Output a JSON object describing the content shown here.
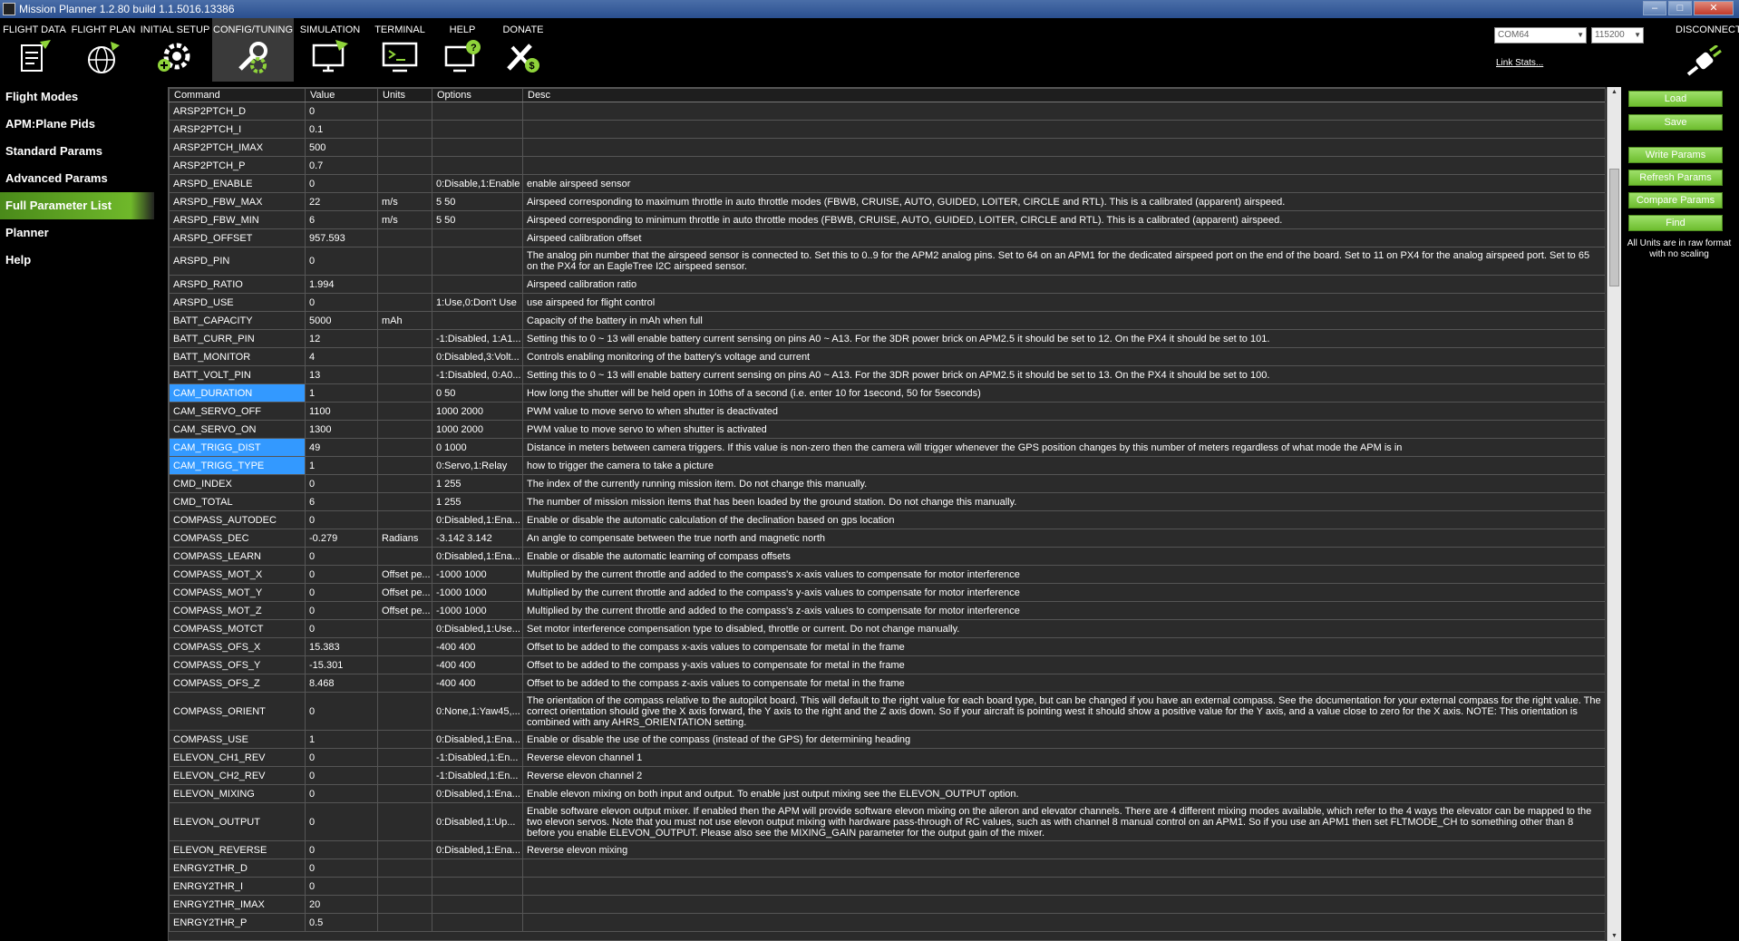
{
  "window": {
    "title": "Mission Planner 1.2.80 build 1.1.5016.13386",
    "controls": [
      "–",
      "□",
      "✕"
    ]
  },
  "toolbar": {
    "items": [
      {
        "label": "FLIGHT DATA",
        "icon": "flight-data-icon"
      },
      {
        "label": "FLIGHT PLAN",
        "icon": "flight-plan-icon"
      },
      {
        "label": "INITIAL SETUP",
        "icon": "initial-setup-icon"
      },
      {
        "label": "CONFIG/TUNING",
        "icon": "config-tuning-icon",
        "active": true
      },
      {
        "label": "SIMULATION",
        "icon": "simulation-icon"
      },
      {
        "label": "TERMINAL",
        "icon": "terminal-icon"
      },
      {
        "label": "HELP",
        "icon": "help-icon"
      },
      {
        "label": "DONATE",
        "icon": "donate-icon"
      }
    ],
    "port": "COM64",
    "baud": "115200",
    "link_stats": "Link Stats...",
    "disconnect": "DISCONNECT"
  },
  "sidebar": {
    "items": [
      {
        "label": "Flight Modes"
      },
      {
        "label": "APM:Plane Pids"
      },
      {
        "label": "Standard Params"
      },
      {
        "label": "Advanced Params"
      },
      {
        "label": "Full Parameter List",
        "active": true
      },
      {
        "label": "Planner"
      },
      {
        "label": "Help"
      }
    ]
  },
  "table": {
    "columns": [
      "Command",
      "Value",
      "Units",
      "Options",
      "Desc"
    ],
    "rows": [
      {
        "cmd": "ARSP2PTCH_D",
        "val": "0",
        "units": "",
        "opt": "",
        "desc": ""
      },
      {
        "cmd": "ARSP2PTCH_I",
        "val": "0.1",
        "units": "",
        "opt": "",
        "desc": ""
      },
      {
        "cmd": "ARSP2PTCH_IMAX",
        "val": "500",
        "units": "",
        "opt": "",
        "desc": ""
      },
      {
        "cmd": "ARSP2PTCH_P",
        "val": "0.7",
        "units": "",
        "opt": "",
        "desc": ""
      },
      {
        "cmd": "ARSPD_ENABLE",
        "val": "0",
        "units": "",
        "opt": "0:Disable,1:Enable",
        "desc": "enable airspeed sensor"
      },
      {
        "cmd": "ARSPD_FBW_MAX",
        "val": "22",
        "units": "m/s",
        "opt": "5 50",
        "desc": "Airspeed corresponding to maximum throttle in auto throttle modes (FBWB, CRUISE, AUTO, GUIDED, LOITER, CIRCLE and RTL). This is a calibrated (apparent) airspeed."
      },
      {
        "cmd": "ARSPD_FBW_MIN",
        "val": "6",
        "units": "m/s",
        "opt": "5 50",
        "desc": "Airspeed corresponding to minimum throttle in auto throttle modes (FBWB, CRUISE, AUTO, GUIDED, LOITER, CIRCLE and RTL). This is a calibrated (apparent) airspeed."
      },
      {
        "cmd": "ARSPD_OFFSET",
        "val": "957.593",
        "units": "",
        "opt": "",
        "desc": "Airspeed calibration offset"
      },
      {
        "cmd": "ARSPD_PIN",
        "val": "0",
        "units": "",
        "opt": "",
        "desc": "The analog pin number that the airspeed sensor is connected to. Set this to 0..9 for the APM2 analog pins. Set to 64 on an APM1 for the dedicated airspeed port on the end of the board. Set to 11 on PX4 for the analog airspeed port. Set to 65 on the PX4 for an EagleTree I2C airspeed sensor.",
        "h": "tall"
      },
      {
        "cmd": "ARSPD_RATIO",
        "val": "1.994",
        "units": "",
        "opt": "",
        "desc": "Airspeed calibration ratio"
      },
      {
        "cmd": "ARSPD_USE",
        "val": "0",
        "units": "",
        "opt": "1:Use,0:Don't Use",
        "desc": "use airspeed for flight control"
      },
      {
        "cmd": "BATT_CAPACITY",
        "val": "5000",
        "units": "mAh",
        "opt": "",
        "desc": "Capacity of the battery in mAh when full"
      },
      {
        "cmd": "BATT_CURR_PIN",
        "val": "12",
        "units": "",
        "opt": "-1:Disabled, 1:A1...",
        "desc": "Setting this to 0 ~ 13 will enable battery current sensing on pins A0 ~ A13. For the 3DR power brick on APM2.5 it should be set to 12. On the PX4 it should be set to 101."
      },
      {
        "cmd": "BATT_MONITOR",
        "val": "4",
        "units": "",
        "opt": "0:Disabled,3:Volt...",
        "desc": "Controls enabling monitoring of the battery's voltage and current"
      },
      {
        "cmd": "BATT_VOLT_PIN",
        "val": "13",
        "units": "",
        "opt": "-1:Disabled, 0:A0...",
        "desc": "Setting this to 0 ~ 13 will enable battery current sensing on pins A0 ~ A13. For the 3DR power brick on APM2.5 it should be set to 13. On the PX4 it should be set to 100."
      },
      {
        "cmd": "CAM_DURATION",
        "val": "1",
        "units": "",
        "opt": "0 50",
        "desc": "How long the shutter will be held open in 10ths of a second (i.e. enter 10 for 1second, 50 for 5seconds)",
        "sel": true
      },
      {
        "cmd": "CAM_SERVO_OFF",
        "val": "1100",
        "units": "",
        "opt": "1000 2000",
        "desc": "PWM value to move servo to when shutter is deactivated"
      },
      {
        "cmd": "CAM_SERVO_ON",
        "val": "1300",
        "units": "",
        "opt": "1000 2000",
        "desc": "PWM value to move servo to when shutter is activated"
      },
      {
        "cmd": "CAM_TRIGG_DIST",
        "val": "49",
        "units": "",
        "opt": "0 1000",
        "desc": "Distance in meters between camera triggers. If this value is non-zero then the camera will trigger whenever the GPS position changes by this number of meters regardless of what mode the APM is in",
        "sel": true
      },
      {
        "cmd": "CAM_TRIGG_TYPE",
        "val": "1",
        "units": "",
        "opt": "0:Servo,1:Relay",
        "desc": "how to trigger the camera to take a picture",
        "sel": true
      },
      {
        "cmd": "CMD_INDEX",
        "val": "0",
        "units": "",
        "opt": "1 255",
        "desc": "The index of the currently running mission item. Do not change this manually."
      },
      {
        "cmd": "CMD_TOTAL",
        "val": "6",
        "units": "",
        "opt": "1 255",
        "desc": "The number of mission mission items that has been loaded by the ground station. Do not change this manually."
      },
      {
        "cmd": "COMPASS_AUTODEC",
        "val": "0",
        "units": "",
        "opt": "0:Disabled,1:Ena...",
        "desc": "Enable or disable the automatic calculation of the declination based on gps location"
      },
      {
        "cmd": "COMPASS_DEC",
        "val": "-0.279",
        "units": "Radians",
        "opt": "-3.142 3.142",
        "desc": "An angle to compensate between the true north and magnetic north"
      },
      {
        "cmd": "COMPASS_LEARN",
        "val": "0",
        "units": "",
        "opt": "0:Disabled,1:Ena...",
        "desc": "Enable or disable the automatic learning of compass offsets"
      },
      {
        "cmd": "COMPASS_MOT_X",
        "val": "0",
        "units": "Offset pe...",
        "opt": "-1000 1000",
        "desc": "Multiplied by the current throttle and added to the compass's x-axis values to compensate for motor interference"
      },
      {
        "cmd": "COMPASS_MOT_Y",
        "val": "0",
        "units": "Offset pe...",
        "opt": "-1000 1000",
        "desc": "Multiplied by the current throttle and added to the compass's y-axis values to compensate for motor interference"
      },
      {
        "cmd": "COMPASS_MOT_Z",
        "val": "0",
        "units": "Offset pe...",
        "opt": "-1000 1000",
        "desc": "Multiplied by the current throttle and added to the compass's z-axis values to compensate for motor interference"
      },
      {
        "cmd": "COMPASS_MOTCT",
        "val": "0",
        "units": "",
        "opt": "0:Disabled,1:Use...",
        "desc": "Set motor interference compensation type to disabled, throttle or current.  Do not change manually."
      },
      {
        "cmd": "COMPASS_OFS_X",
        "val": "15.383",
        "units": "",
        "opt": "-400 400",
        "desc": "Offset to be added to the compass x-axis values to compensate for metal in the frame"
      },
      {
        "cmd": "COMPASS_OFS_Y",
        "val": "-15.301",
        "units": "",
        "opt": "-400 400",
        "desc": "Offset to be added to the compass y-axis values to compensate for metal in the frame"
      },
      {
        "cmd": "COMPASS_OFS_Z",
        "val": "8.468",
        "units": "",
        "opt": "-400 400",
        "desc": "Offset to be added to the compass z-axis values to compensate for metal in the frame"
      },
      {
        "cmd": "COMPASS_ORIENT",
        "val": "0",
        "units": "",
        "opt": "0:None,1:Yaw45,...",
        "desc": "The orientation of the compass relative to the autopilot board. This will default to the right value for each board type, but can be changed if you have an external compass. See the documentation for your external compass for the right value. The correct orientation should give the X axis forward, the Y axis to the right and the Z axis down. So if your aircraft is pointing west it should show a positive value for the Y axis, and a value close to zero for the X axis. NOTE: This orientation is combined with any AHRS_ORIENTATION setting.",
        "h": "xtall"
      },
      {
        "cmd": "COMPASS_USE",
        "val": "1",
        "units": "",
        "opt": "0:Disabled,1:Ena...",
        "desc": "Enable or disable the use of the compass (instead of the GPS) for determining heading"
      },
      {
        "cmd": "ELEVON_CH1_REV",
        "val": "0",
        "units": "",
        "opt": "-1:Disabled,1:En...",
        "desc": "Reverse elevon channel 1"
      },
      {
        "cmd": "ELEVON_CH2_REV",
        "val": "0",
        "units": "",
        "opt": "-1:Disabled,1:En...",
        "desc": "Reverse elevon channel 2"
      },
      {
        "cmd": "ELEVON_MIXING",
        "val": "0",
        "units": "",
        "opt": "0:Disabled,1:Ena...",
        "desc": "Enable elevon mixing  on both input and output. To enable just output mixing see the ELEVON_OUTPUT option."
      },
      {
        "cmd": "ELEVON_OUTPUT",
        "val": "0",
        "units": "",
        "opt": "0:Disabled,1:Up...",
        "desc": "Enable software elevon output mixer. If enabled then the APM will provide software elevon mixing on the aileron and elevator channels. There are 4 different mixing modes available, which refer to the 4 ways the elevator can be mapped to the two elevon servos. Note that you must not use elevon output mixing with hardware pass-through of RC values, such as with channel 8 manual control on an APM1. So if you use an APM1 then set FLTMODE_CH to something other than 8 before you enable ELEVON_OUTPUT. Please also see the MIXING_GAIN parameter for the output gain of the mixer.",
        "h": "xtall"
      },
      {
        "cmd": "ELEVON_REVERSE",
        "val": "0",
        "units": "",
        "opt": "0:Disabled,1:Ena...",
        "desc": "Reverse elevon mixing"
      },
      {
        "cmd": "ENRGY2THR_D",
        "val": "0",
        "units": "",
        "opt": "",
        "desc": ""
      },
      {
        "cmd": "ENRGY2THR_I",
        "val": "0",
        "units": "",
        "opt": "",
        "desc": ""
      },
      {
        "cmd": "ENRGY2THR_IMAX",
        "val": "20",
        "units": "",
        "opt": "",
        "desc": ""
      },
      {
        "cmd": "ENRGY2THR_P",
        "val": "0.5",
        "units": "",
        "opt": "",
        "desc": ""
      }
    ]
  },
  "right_panel": {
    "buttons": [
      "Load",
      "Save",
      "Write Params",
      "Refresh Params",
      "Compare Params",
      "Find"
    ],
    "note": "All Units are in raw format with no scaling"
  },
  "colors": {
    "accent_green": "#6dbd2e",
    "selection_blue": "#3399ff",
    "title_bar": "#2a4f8f"
  }
}
